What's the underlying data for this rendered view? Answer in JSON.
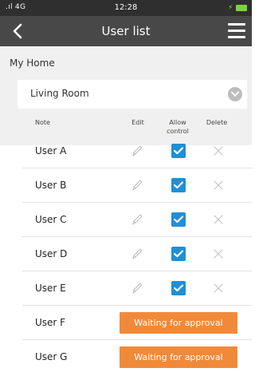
{
  "status_bar": {
    "signal": ".ıl 4G",
    "time": "12:28",
    "battery_color": "#7ed33d"
  },
  "header": {
    "title": "User list",
    "back_icon": "chevron-left-icon",
    "menu_icon": "hamburger-menu-icon",
    "background": "#484848"
  },
  "home": {
    "name": "My Home"
  },
  "room_select": {
    "selected": "Living Room",
    "icon": "chevron-down-circle-icon"
  },
  "columns": {
    "note": "Note",
    "edit": "Edit",
    "allow_line1": "Allow",
    "allow_line2": "control",
    "delete": "Delete"
  },
  "users": [
    {
      "name": "User A",
      "allow_control": true
    },
    {
      "name": "User B",
      "allow_control": true
    },
    {
      "name": "User C",
      "allow_control": true
    },
    {
      "name": "User D",
      "allow_control": true
    },
    {
      "name": "User E",
      "allow_control": true
    }
  ],
  "pending_users": [
    {
      "name": "User F",
      "status": "Waiting for approval"
    },
    {
      "name": "User G",
      "status": "Waiting for approval"
    }
  ],
  "colors": {
    "checkbox": "#1f8fd6",
    "waiting_button": "#f08a3a"
  }
}
